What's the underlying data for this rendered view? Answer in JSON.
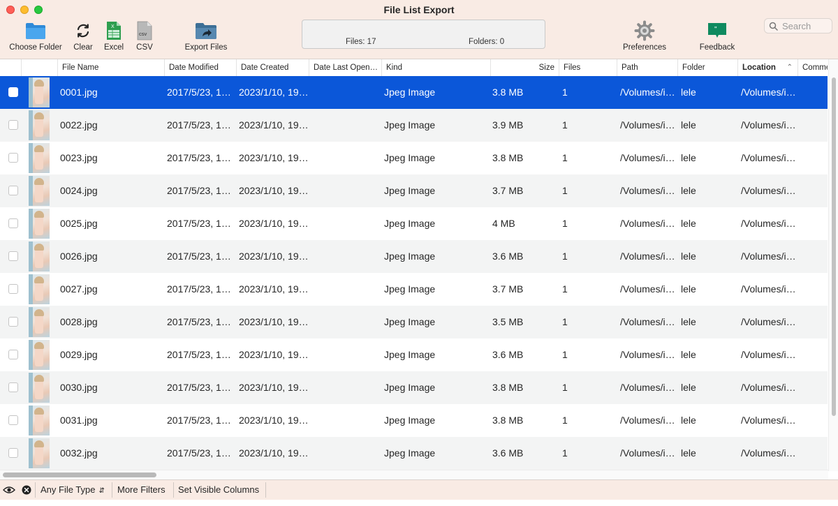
{
  "window": {
    "title": "File List Export"
  },
  "toolbar": {
    "choose_folder": "Choose Folder",
    "clear": "Clear",
    "excel": "Excel",
    "csv": "CSV",
    "export_files": "Export Files",
    "preferences": "Preferences",
    "feedback": "Feedback",
    "excel_icon_text": "X",
    "csv_icon_text": "csv"
  },
  "status": {
    "files": "Files: 17",
    "folders": "Folders: 0"
  },
  "search": {
    "placeholder": "Search"
  },
  "colors": {
    "selection": "#0b57d9",
    "toolbar_bg": "#f9ebe4",
    "alt_row": "#f3f4f4",
    "folder_icon": "#3a97e0"
  },
  "table": {
    "columns": [
      "File Name",
      "Date Modified",
      "Date Created",
      "Date Last Open…",
      "Kind",
      "Size",
      "Files",
      "Path",
      "Folder",
      "Location",
      "Comme"
    ],
    "sorted_column": "Location",
    "selected_row": 0,
    "rows": [
      {
        "name": "0001.jpg",
        "modified": "2017/5/23, 1…",
        "created": "2023/1/10, 19…",
        "opened": "",
        "kind": "Jpeg Image",
        "size": "3.8 MB",
        "files": "1",
        "path": "/Volumes/i…",
        "folder": "lele",
        "location": "/Volumes/i…"
      },
      {
        "name": "0022.jpg",
        "modified": "2017/5/23, 1…",
        "created": "2023/1/10, 19…",
        "opened": "",
        "kind": "Jpeg Image",
        "size": "3.9 MB",
        "files": "1",
        "path": "/Volumes/i…",
        "folder": "lele",
        "location": "/Volumes/i…"
      },
      {
        "name": "0023.jpg",
        "modified": "2017/5/23, 1…",
        "created": "2023/1/10, 19…",
        "opened": "",
        "kind": "Jpeg Image",
        "size": "3.8 MB",
        "files": "1",
        "path": "/Volumes/i…",
        "folder": "lele",
        "location": "/Volumes/i…"
      },
      {
        "name": "0024.jpg",
        "modified": "2017/5/23, 1…",
        "created": "2023/1/10, 19…",
        "opened": "",
        "kind": "Jpeg Image",
        "size": "3.7 MB",
        "files": "1",
        "path": "/Volumes/i…",
        "folder": "lele",
        "location": "/Volumes/i…"
      },
      {
        "name": "0025.jpg",
        "modified": "2017/5/23, 1…",
        "created": "2023/1/10, 19…",
        "opened": "",
        "kind": "Jpeg Image",
        "size": "4 MB",
        "files": "1",
        "path": "/Volumes/i…",
        "folder": "lele",
        "location": "/Volumes/i…"
      },
      {
        "name": "0026.jpg",
        "modified": "2017/5/23, 1…",
        "created": "2023/1/10, 19…",
        "opened": "",
        "kind": "Jpeg Image",
        "size": "3.6 MB",
        "files": "1",
        "path": "/Volumes/i…",
        "folder": "lele",
        "location": "/Volumes/i…"
      },
      {
        "name": "0027.jpg",
        "modified": "2017/5/23, 1…",
        "created": "2023/1/10, 19…",
        "opened": "",
        "kind": "Jpeg Image",
        "size": "3.7 MB",
        "files": "1",
        "path": "/Volumes/i…",
        "folder": "lele",
        "location": "/Volumes/i…"
      },
      {
        "name": "0028.jpg",
        "modified": "2017/5/23, 1…",
        "created": "2023/1/10, 19…",
        "opened": "",
        "kind": "Jpeg Image",
        "size": "3.5 MB",
        "files": "1",
        "path": "/Volumes/i…",
        "folder": "lele",
        "location": "/Volumes/i…"
      },
      {
        "name": "0029.jpg",
        "modified": "2017/5/23, 1…",
        "created": "2023/1/10, 19…",
        "opened": "",
        "kind": "Jpeg Image",
        "size": "3.6 MB",
        "files": "1",
        "path": "/Volumes/i…",
        "folder": "lele",
        "location": "/Volumes/i…"
      },
      {
        "name": "0030.jpg",
        "modified": "2017/5/23, 1…",
        "created": "2023/1/10, 19…",
        "opened": "",
        "kind": "Jpeg Image",
        "size": "3.8 MB",
        "files": "1",
        "path": "/Volumes/i…",
        "folder": "lele",
        "location": "/Volumes/i…"
      },
      {
        "name": "0031.jpg",
        "modified": "2017/5/23, 1…",
        "created": "2023/1/10, 19…",
        "opened": "",
        "kind": "Jpeg Image",
        "size": "3.8 MB",
        "files": "1",
        "path": "/Volumes/i…",
        "folder": "lele",
        "location": "/Volumes/i…"
      },
      {
        "name": "0032.jpg",
        "modified": "2017/5/23, 1…",
        "created": "2023/1/10, 19…",
        "opened": "",
        "kind": "Jpeg Image",
        "size": "3.6 MB",
        "files": "1",
        "path": "/Volumes/i…",
        "folder": "lele",
        "location": "/Volumes/i…"
      }
    ]
  },
  "bottom": {
    "file_type": "Any File Type",
    "more_filters": "More Filters",
    "visible_columns": "Set Visible Columns"
  }
}
